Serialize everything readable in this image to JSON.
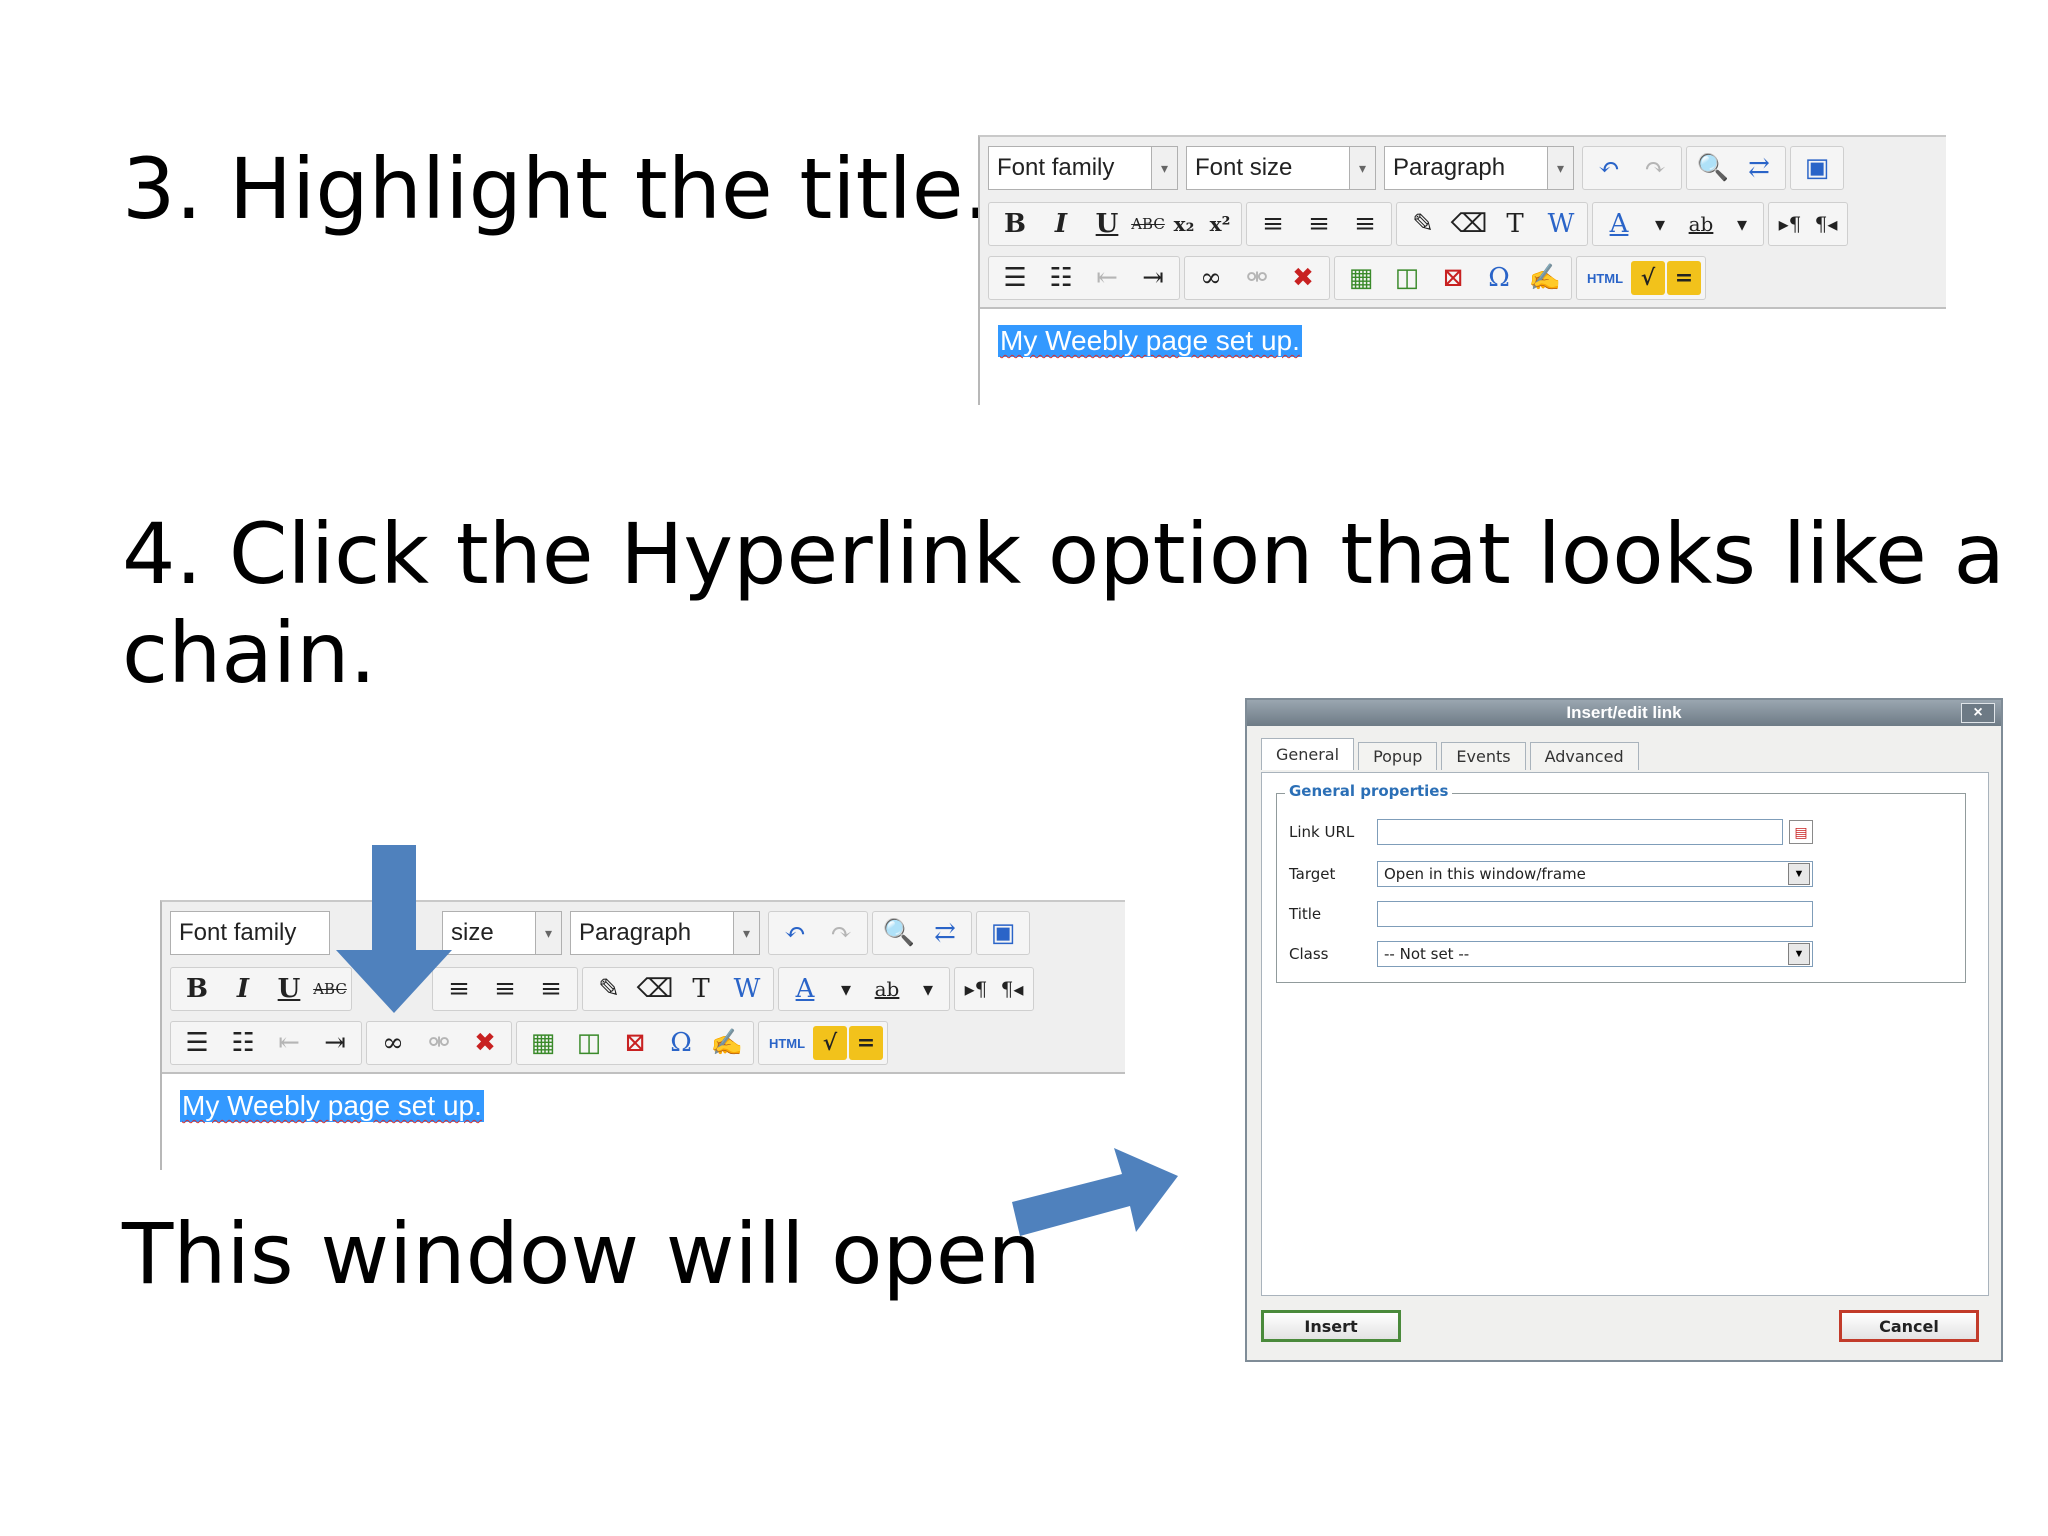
{
  "steps": {
    "step3": "3. Highlight the title.",
    "step4_line1": "4. Click the Hyperlink option that looks like a",
    "step4_line2": "chain.",
    "window_note": "This window will open"
  },
  "editor": {
    "font_family_label": "Font family",
    "font_size_label": "Font size",
    "font_size_partial_label": "size",
    "format_label": "Paragraph",
    "selected_text": "My Weebly page set up."
  },
  "icons": {
    "undo": "↶",
    "redo": "↷",
    "find": "🔍",
    "replace": "⇄",
    "fullscreen": "▣",
    "bold": "B",
    "italic": "I",
    "underline": "U",
    "strike": "ABC",
    "subscript": "x₂",
    "superscript": "x²",
    "align_left": "≡",
    "align_center": "≡",
    "align_right": "≡",
    "cleanup": "✎",
    "eraser": "⌫",
    "paste_text": "T",
    "paste_word": "W",
    "font_color": "A",
    "highlight": "ab",
    "ltr": "▸¶",
    "rtl": "¶◂",
    "bullets": "☰",
    "numbers": "☷",
    "outdent": "⇤",
    "indent": "⇥",
    "link": "∞",
    "unlink": "⚮",
    "anchor_remove": "✖",
    "image": "▦",
    "media": "◫",
    "insert_special": "⊠",
    "omega": "Ω",
    "edit": "✍",
    "html": "HTML",
    "sqrt": "√",
    "equals": "="
  },
  "dialog": {
    "title": "Insert/edit link",
    "close": "×",
    "tabs": [
      "General",
      "Popup",
      "Events",
      "Advanced"
    ],
    "legend": "General properties",
    "fields": {
      "link_url_label": "Link URL",
      "link_url_value": "",
      "target_label": "Target",
      "target_value": "Open in this window/frame",
      "title_label": "Title",
      "title_value": "",
      "class_label": "Class",
      "class_value": "-- Not set --"
    },
    "insert_label": "Insert",
    "cancel_label": "Cancel"
  },
  "colors": {
    "arrow": "#4f81bd",
    "selection": "#3399ff",
    "legend": "#2b6fb6",
    "insert_border": "#4a8a3b",
    "cancel_border": "#c23b2a"
  }
}
